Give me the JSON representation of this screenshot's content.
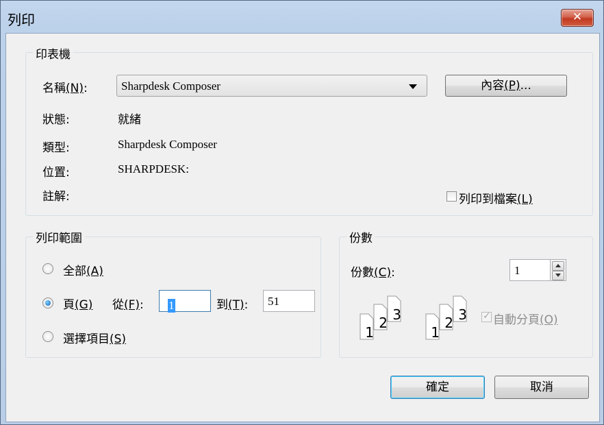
{
  "window": {
    "title": "列印",
    "close_label": "✕"
  },
  "printer_group": {
    "label": "印表機",
    "name_label": "名稱",
    "name_key": "(N)",
    "name_colon": ":",
    "selected_printer": "Sharpdesk Composer",
    "properties_label": "內容",
    "properties_key": "(P)",
    "properties_ellipsis": "...",
    "status_label": "狀態:",
    "status_value": "就緒",
    "type_label": "類型:",
    "type_value": "Sharpdesk Composer",
    "where_label": "位置:",
    "where_value": "SHARPDESK:",
    "comment_label": "註解:",
    "print_to_file_label": "列印到檔案",
    "print_to_file_key": "(L)",
    "print_to_file_checked": false
  },
  "range_group": {
    "label": "列印範圍",
    "all_label": "全部",
    "all_key": "(A)",
    "pages_label": "頁",
    "pages_key": "(G)",
    "from_label": "從",
    "from_key": "(F)",
    "from_colon": ":",
    "from_value": "1",
    "to_label": "到",
    "to_key": "(T)",
    "to_colon": ":",
    "to_value": "51",
    "selection_label": "選擇項目",
    "selection_key": "(S)",
    "selected_option": "pages"
  },
  "copies_group": {
    "label": "份數",
    "copies_label": "份數",
    "copies_key": "(C)",
    "copies_colon": ":",
    "copies_value": "1",
    "collate_label": "自動分頁",
    "collate_key": "(O)",
    "collate_checked": true,
    "collate_enabled": false,
    "collate_numbers": [
      "1",
      "2",
      "3"
    ]
  },
  "buttons": {
    "ok_label": "確定",
    "cancel_label": "取消"
  }
}
